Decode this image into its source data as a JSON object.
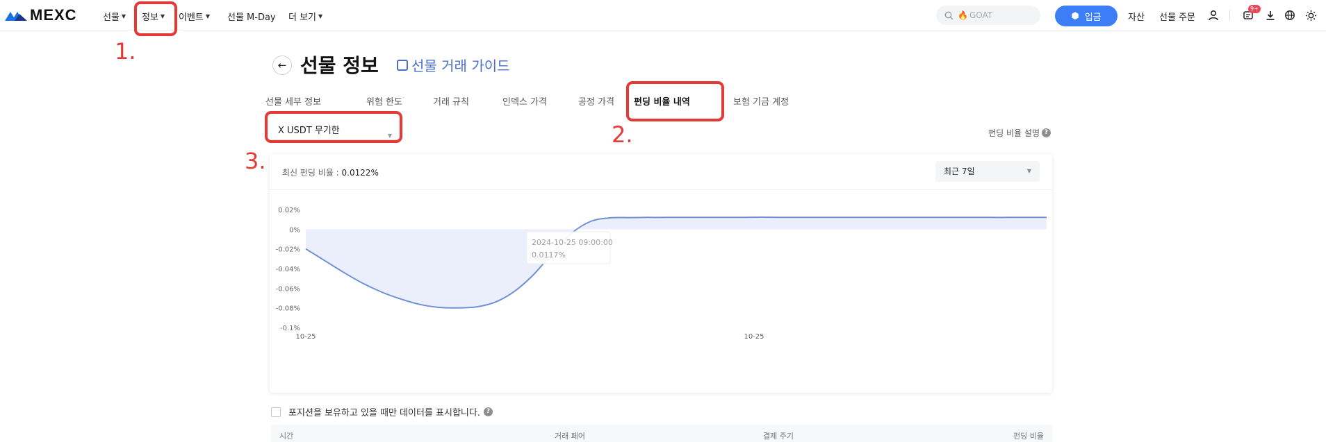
{
  "nav": {
    "logo_text": "MEXC",
    "items": [
      "선물",
      "정보",
      "이벤트",
      "선물 M-Day",
      "더 보기"
    ],
    "search_placeholder": "GOAT",
    "deposit_label": "입금",
    "links": [
      "자산",
      "선물 주문"
    ],
    "notification_badge": "9+"
  },
  "annotations": [
    "1.",
    "2.",
    "3."
  ],
  "page": {
    "title": "선물 정보",
    "guide_link": "선물 거래 가이드",
    "tabs": [
      "선물 세부 정보",
      "위험 한도",
      "거래 규칙",
      "인덱스 가격",
      "공정 가격",
      "펀딩 비율 내역",
      "보험 기금 계정"
    ],
    "active_tab": "펀딩 비율 내역",
    "symbol": "X USDT 무기한",
    "funding_explain": "펀딩 비율 설명"
  },
  "card": {
    "latest_label": "최신 펀딩 비율 : ",
    "latest_value": "0.0122%",
    "range": "최근 7일"
  },
  "tooltip": {
    "time": "2024-10-25 09:00:00",
    "value": "0.0117%"
  },
  "chart_data": {
    "type": "area",
    "y_ticks": [
      "0.02%",
      "0%",
      "-0.02%",
      "-0.04%",
      "-0.06%",
      "-0.08%",
      "-0.1%"
    ],
    "x_ticks": [
      "10-25",
      "10-25"
    ],
    "ylim": [
      -0.1,
      0.02
    ],
    "unit": "%",
    "points": [
      -0.02,
      -0.032,
      -0.044,
      -0.055,
      -0.064,
      -0.071,
      -0.0765,
      -0.0795,
      -0.08,
      -0.079,
      -0.074,
      -0.063,
      -0.046,
      -0.024,
      -0.004,
      0.008,
      0.0115,
      0.0118,
      0.012,
      0.012,
      0.0121,
      0.0121,
      0.0121,
      0.0121,
      0.0122,
      0.0121,
      0.0121,
      0.0121,
      0.0121,
      0.0121,
      0.0121,
      0.0121,
      0.0121,
      0.0121,
      0.0121,
      0.0121,
      0.012,
      0.012,
      0.012,
      0.012
    ],
    "line_color": "#6f8fd6",
    "fill_color": "#e6ebfb"
  },
  "filter_label": "포지션을 보유하고 있을 때만 데이터를 표시합니다.",
  "table": {
    "headers": [
      "시간",
      "거래 페어",
      "결제 주기",
      "펀딩 비율"
    ]
  }
}
